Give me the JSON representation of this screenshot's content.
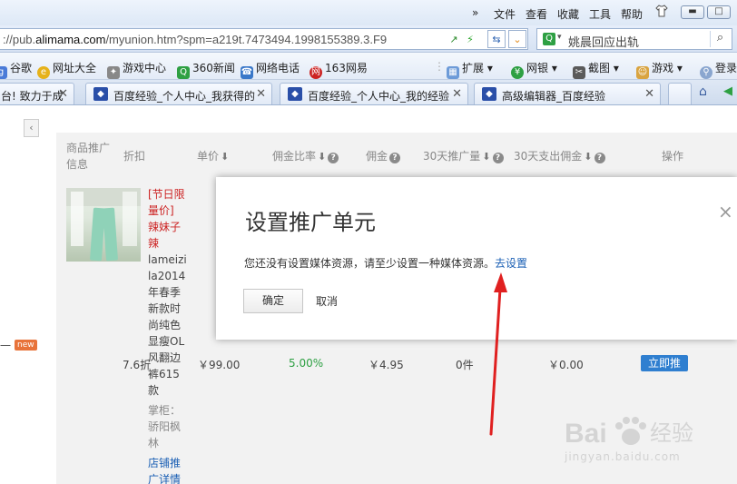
{
  "browser": {
    "menu": [
      "文件",
      "查看",
      "收藏",
      "工具",
      "帮助"
    ],
    "url_prefix": "://pub.",
    "url_domain": "alimama.com",
    "url_rest": "/myunion.htm?spm=a219t.7473494.1998155389.3.F9",
    "search_text": "姚晨回应出轨",
    "favorites": [
      "谷歌",
      "网址大全",
      "游戏中心",
      "360新闻",
      "网络电话",
      "163网易",
      "扩展",
      "网银",
      "截图",
      "游戏",
      "登录"
    ],
    "tabs": [
      {
        "label": "台! 致力于成"
      },
      {
        "label": "百度经验_个人中心_我获得的"
      },
      {
        "label": "百度经验_个人中心_我的经验"
      },
      {
        "label": "高级编辑器_百度经验"
      }
    ]
  },
  "table": {
    "headers": [
      "商品推广信息",
      "折扣",
      "单价",
      "佣金比率",
      "佣金",
      "30天推广量",
      "30天支出佣金",
      "操作"
    ],
    "product": {
      "promo_tag": "[节日限量价]",
      "shop_tag": "辣妹子辣",
      "title": "lameizila2014年春季新款时尚纯色显瘦OL风翻边裤615款",
      "seller_label": "掌柜：",
      "seller": "骄阳枫林",
      "detail_link": "店铺推广详情"
    },
    "row": {
      "discount": "7.6折",
      "price": "￥99.00",
      "rate": "5.00%",
      "commission": "￥4.95",
      "volume": "0件",
      "spent": "￥0.00",
      "action": "立即推"
    },
    "new_badge": "new"
  },
  "dialog": {
    "title": "设置推广单元",
    "message": "您还没有设置媒体资源，请至少设置一种媒体资源。",
    "link": "去设置",
    "ok": "确定",
    "cancel": "取消",
    "close": "×"
  },
  "watermark": {
    "logo": "Bai经验",
    "url": "jingyan.baidu.com"
  }
}
